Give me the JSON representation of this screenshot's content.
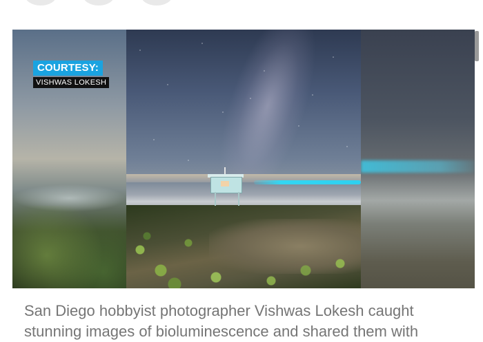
{
  "video": {
    "badge_title": "COURTESY:",
    "badge_name": "VISHWAS LOKESH"
  },
  "caption": {
    "text": "San Diego hobbyist photographer Vishwas Lokesh caught stunning images of bioluminescence and shared them with"
  },
  "colors": {
    "badge_blue": "#1aa3e0",
    "wave_cyan": "#2ed0f0",
    "caption_gray": "#757575"
  }
}
